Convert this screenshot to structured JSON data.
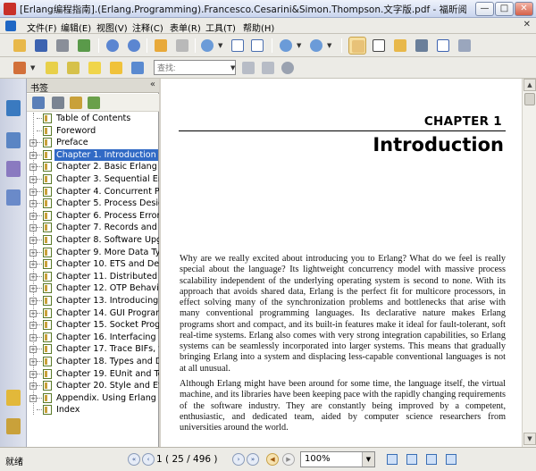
{
  "window": {
    "title": "[Erlang编程指南].(Erlang.Programming).Francesco.Cesarini&Simon.Thompson.文字版.pdf - 福昕阅读器 - [[Erlang...",
    "minimize_glyph": "—",
    "maximize_glyph": "□",
    "close_glyph": "✕"
  },
  "menu": {
    "items": [
      "文件(F)",
      "编辑(E)",
      "视图(V)",
      "注释(C)",
      "表单(R)",
      "工具(T)",
      "帮助(H)"
    ]
  },
  "toolbar": {
    "search_placeholder": "查找:"
  },
  "bookmarks": {
    "title": "书签",
    "collapse_glyph": "«",
    "items": [
      {
        "label": "Table of Contents",
        "expandable": false
      },
      {
        "label": "Foreword",
        "expandable": false
      },
      {
        "label": "Preface",
        "expandable": true
      },
      {
        "label": "Chapter 1. Introduction",
        "expandable": true,
        "selected": true
      },
      {
        "label": "Chapter 2. Basic Erlang",
        "expandable": true
      },
      {
        "label": "Chapter 3. Sequential Erlang",
        "expandable": true
      },
      {
        "label": "Chapter 4. Concurrent Pro",
        "expandable": true
      },
      {
        "label": "Chapter 5. Process Design",
        "expandable": true
      },
      {
        "label": "Chapter 6. Process Error H",
        "expandable": true
      },
      {
        "label": "Chapter 7. Records and Ma",
        "expandable": true
      },
      {
        "label": "Chapter 8. Software Upgra",
        "expandable": true
      },
      {
        "label": "Chapter 9. More Data Type",
        "expandable": true
      },
      {
        "label": "Chapter 10. ETS and Dets",
        "expandable": true
      },
      {
        "label": "Chapter 11. Distributed Pro",
        "expandable": true
      },
      {
        "label": "Chapter 12. OTP Behavior",
        "expandable": true
      },
      {
        "label": "Chapter 13. Introducing M",
        "expandable": true
      },
      {
        "label": "Chapter 14. GUI Programm",
        "expandable": true
      },
      {
        "label": "Chapter 15. Socket Progra",
        "expandable": true
      },
      {
        "label": "Chapter 16. Interfacing Erl",
        "expandable": true
      },
      {
        "label": "Chapter 17. Trace BIFs, th",
        "expandable": true
      },
      {
        "label": "Chapter 18. Types and Do",
        "expandable": true
      },
      {
        "label": "Chapter 19. EUnit and Tes",
        "expandable": true
      },
      {
        "label": "Chapter 20. Style and Effic",
        "expandable": true
      },
      {
        "label": "Appendix. Using Erlang",
        "expandable": true
      },
      {
        "label": "Index",
        "expandable": false
      }
    ]
  },
  "document": {
    "chapter_label": "CHAPTER 1",
    "chapter_title": "Introduction",
    "paragraphs": [
      "Why are we really excited about introducing you to Erlang? What do we feel is really special about the language? Its lightweight concurrency model with massive process scalability independent of the underlying operating system is second to none. With its approach that avoids shared data, Erlang is the perfect fit for multicore processors, in effect solving many of the synchronization problems and bottlenecks that arise with many conventional programming languages. Its declarative nature makes Erlang programs short and compact, and its built-in features make it ideal for fault-tolerant, soft real-time systems. Erlang also comes with very strong integration capabilities, so Erlang systems can be seamlessly incorporated into larger systems. This means that gradually bringing Erlang into a system and displacing less-capable conventional languages is not at all unusual.",
      "Although Erlang might have been around for some time, the language itself, the virtual machine, and its libraries have been keeping pace with the rapidly changing requirements of the software industry. They are constantly being improved by a competent, enthusiastic, and dedicated team, aided by computer science researchers from universities around the world."
    ]
  },
  "status": {
    "text": "就绪",
    "page_indicator": "1 ( 25 / 496 )",
    "zoom": "100%"
  },
  "colors": {
    "selection": "#316ac5",
    "toolbar_bg": "#ecebe6"
  }
}
